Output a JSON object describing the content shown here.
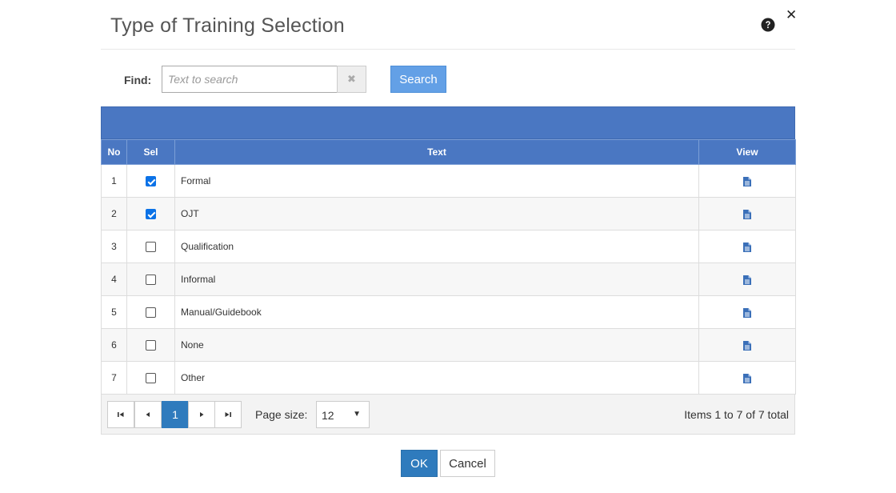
{
  "dialog": {
    "title": "Type of Training Selection",
    "help_icon": "question-circle-icon",
    "close_icon": "close-icon",
    "close_glyph": "✕"
  },
  "search": {
    "find_label": "Find:",
    "placeholder": "Text to search",
    "value": "",
    "clear_icon": "clear-x-icon",
    "clear_glyph": "✖",
    "search_label": "Search"
  },
  "grid": {
    "columns": {
      "no": "No",
      "sel": "Sel",
      "text": "Text",
      "view": "View"
    },
    "view_icon": "document-icon",
    "rows": [
      {
        "no": "1",
        "checked": true,
        "text": "Formal"
      },
      {
        "no": "2",
        "checked": true,
        "text": "OJT"
      },
      {
        "no": "3",
        "checked": false,
        "text": "Qualification"
      },
      {
        "no": "4",
        "checked": false,
        "text": "Informal"
      },
      {
        "no": "5",
        "checked": false,
        "text": "Manual/Guidebook"
      },
      {
        "no": "6",
        "checked": false,
        "text": "None"
      },
      {
        "no": "7",
        "checked": false,
        "text": "Other"
      }
    ]
  },
  "pager": {
    "first_glyph": "⏮",
    "prev_glyph": "◀",
    "current_page": "1",
    "next_glyph": "▶",
    "last_glyph": "⏭",
    "page_size_label": "Page size:",
    "page_size_value": "12",
    "dropdown_glyph": "▼",
    "items_info": "Items 1 to 7 of 7 total"
  },
  "footer": {
    "ok_label": "OK",
    "cancel_label": "Cancel"
  },
  "colors": {
    "header_blue": "#4a77c2",
    "primary_button": "#2f7bbd",
    "search_button": "#63a0e6",
    "checkbox_checked": "#0b72e7",
    "icon_blue": "#3a6fb8"
  }
}
